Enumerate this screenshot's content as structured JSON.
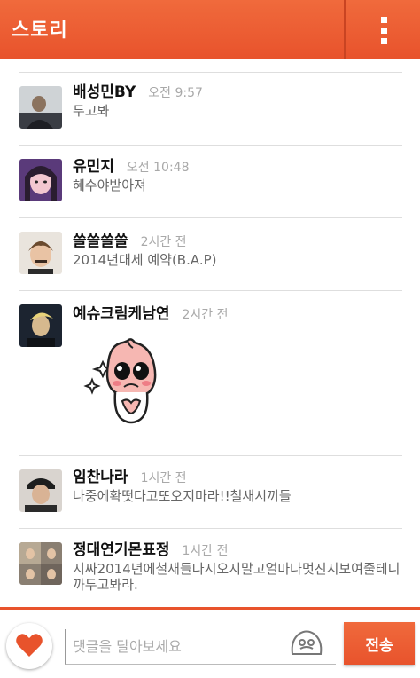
{
  "header": {
    "title": "스토리",
    "menu_icon": "vertical-dots-icon",
    "bar_color": "#e8532c"
  },
  "comments": [
    {
      "name": "배성민BY",
      "time": "오전 9:57",
      "text": "두고봐"
    },
    {
      "name": "유민지",
      "time": "오전 10:48",
      "text": "혜수야받아져"
    },
    {
      "name": "쓸쓸쓸쓸",
      "time": "2시간 전",
      "text": "2014년대세 예약(B.A.P)"
    },
    {
      "name": "예슈크림케남연",
      "time": "2시간 전",
      "text": "",
      "sticker": "crying-peach-sticker"
    },
    {
      "name": "임찬나라",
      "time": "1시간 전",
      "text": "나중에확떳다고또오지마라!!철새시끼들"
    },
    {
      "name": "정대연기몬표정",
      "time": "1시간 전",
      "text": "지짜2014년에철새들다시오지말고얼마나멋진지보여줄테니까두고봐라."
    }
  ],
  "composer": {
    "like_icon": "heart-icon",
    "placeholder": "댓글을 달아보세요",
    "emoticon_icon": "emoticon-face-icon",
    "send_label": "전송"
  }
}
